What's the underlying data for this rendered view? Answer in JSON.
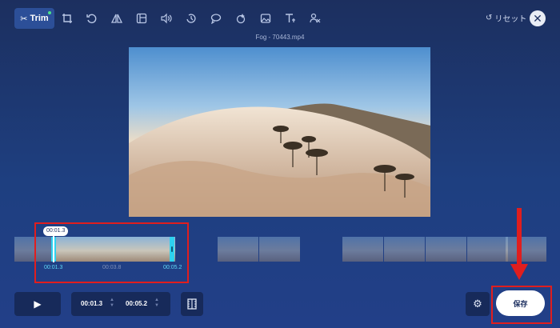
{
  "toolbar": {
    "items": [
      {
        "name": "trim",
        "label": "Trim",
        "icon": "scissors-icon",
        "active": true
      },
      {
        "name": "crop",
        "icon": "crop-icon"
      },
      {
        "name": "rotate",
        "icon": "rotate-icon"
      },
      {
        "name": "flip",
        "icon": "flip-icon"
      },
      {
        "name": "ratio",
        "icon": "frame-icon"
      },
      {
        "name": "volume",
        "icon": "volume-icon"
      },
      {
        "name": "speed",
        "icon": "speed-icon"
      },
      {
        "name": "loop",
        "icon": "loop-icon"
      },
      {
        "name": "animation",
        "icon": "animation-icon"
      },
      {
        "name": "image",
        "icon": "image-icon"
      },
      {
        "name": "text",
        "icon": "text-icon"
      },
      {
        "name": "remove",
        "icon": "eraser-icon"
      }
    ]
  },
  "header": {
    "reset_label": "リセット",
    "filename": "Fog - 70443.mp4"
  },
  "timeline": {
    "tooltip": "00:01.3",
    "start": "00:01.3",
    "mid": "00:03.8",
    "end": "00:05.2"
  },
  "controls": {
    "start_time": "00:01.3",
    "end_time": "00:05.2",
    "save_label": "保存"
  },
  "colors": {
    "accent": "#2ed2f0",
    "highlight": "#e01e1e",
    "background": "#1e3f80"
  }
}
